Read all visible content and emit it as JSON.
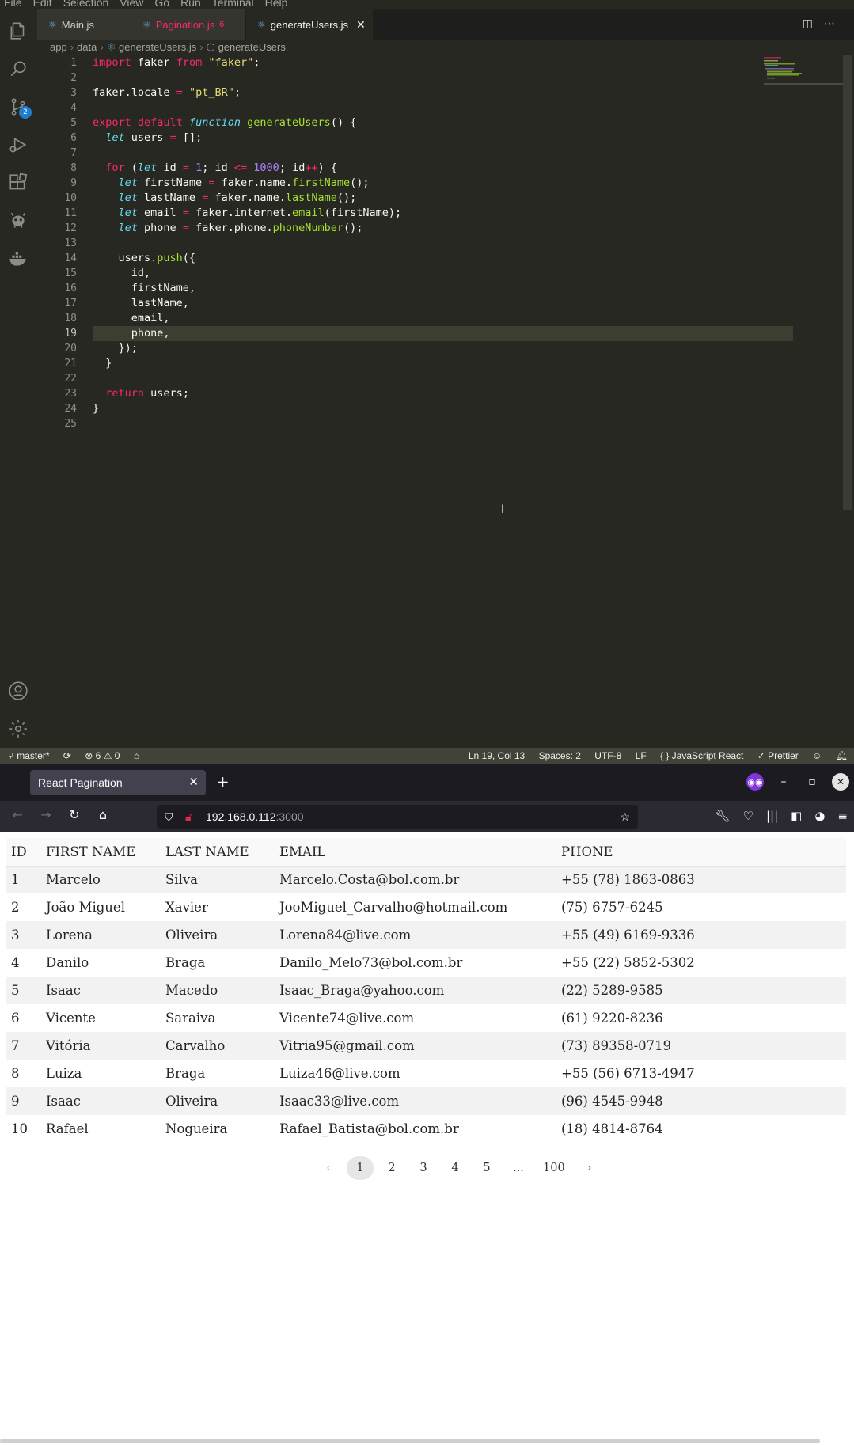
{
  "vscode": {
    "menu": [
      "File",
      "Edit",
      "Selection",
      "View",
      "Go",
      "Run",
      "Terminal",
      "Help"
    ],
    "scm_badge": "2",
    "tabs": [
      {
        "label": "Main.js",
        "count": ""
      },
      {
        "label": "Pagination.js",
        "count": "6"
      },
      {
        "label": "generateUsers.js",
        "count": ""
      }
    ],
    "breadcrumb": [
      "app",
      "data",
      "generateUsers.js",
      "generateUsers"
    ],
    "line_numbers": [
      "1",
      "2",
      "3",
      "4",
      "5",
      "6",
      "7",
      "8",
      "9",
      "10",
      "11",
      "12",
      "13",
      "14",
      "15",
      "16",
      "17",
      "18",
      "19",
      "20",
      "21",
      "22",
      "23",
      "24",
      "25"
    ],
    "status": {
      "branch": "master*",
      "problems": "⊗ 6 ⚠ 0",
      "cursor": "Ln 19, Col 13",
      "spaces": "Spaces: 2",
      "encoding": "UTF-8",
      "eol": "LF",
      "language": "{ } JavaScript React",
      "formatter": "✓ Prettier"
    },
    "colors": {
      "editor_bg": "#272822",
      "keyword": "#f92672",
      "string": "#e6db74",
      "function": "#a6e22e",
      "number": "#ae81ff"
    }
  },
  "firefox": {
    "tab_title": "React Pagination",
    "url_host": "192.168.0.112",
    "url_port": ":3000"
  },
  "app": {
    "columns": [
      "ID",
      "FIRST NAME",
      "LAST NAME",
      "EMAIL",
      "PHONE"
    ],
    "rows": [
      {
        "id": "1",
        "first": "Marcelo",
        "last": "Silva",
        "email": "Marcelo.Costa@bol.com.br",
        "phone": "+55 (78) 1863-0863"
      },
      {
        "id": "2",
        "first": "João Miguel",
        "last": "Xavier",
        "email": "JooMiguel_Carvalho@hotmail.com",
        "phone": "(75) 6757-6245"
      },
      {
        "id": "3",
        "first": "Lorena",
        "last": "Oliveira",
        "email": "Lorena84@live.com",
        "phone": "+55 (49) 6169-9336"
      },
      {
        "id": "4",
        "first": "Danilo",
        "last": "Braga",
        "email": "Danilo_Melo73@bol.com.br",
        "phone": "+55 (22) 5852-5302"
      },
      {
        "id": "5",
        "first": "Isaac",
        "last": "Macedo",
        "email": "Isaac_Braga@yahoo.com",
        "phone": "(22) 5289-9585"
      },
      {
        "id": "6",
        "first": "Vicente",
        "last": "Saraiva",
        "email": "Vicente74@live.com",
        "phone": "(61) 9220-8236"
      },
      {
        "id": "7",
        "first": "Vitória",
        "last": "Carvalho",
        "email": "Vitria95@gmail.com",
        "phone": "(73) 89358-0719"
      },
      {
        "id": "8",
        "first": "Luiza",
        "last": "Braga",
        "email": "Luiza46@live.com",
        "phone": "+55 (56) 6713-4947"
      },
      {
        "id": "9",
        "first": "Isaac",
        "last": "Oliveira",
        "email": "Isaac33@live.com",
        "phone": "(96) 4545-9948"
      },
      {
        "id": "10",
        "first": "Rafael",
        "last": "Nogueira",
        "email": "Rafael_Batista@bol.com.br",
        "phone": "(18) 4814-8764"
      }
    ],
    "pagination": {
      "prev": "‹",
      "pages": [
        "1",
        "2",
        "3",
        "4",
        "5",
        "...",
        "100"
      ],
      "current": "1",
      "next": "›"
    }
  }
}
